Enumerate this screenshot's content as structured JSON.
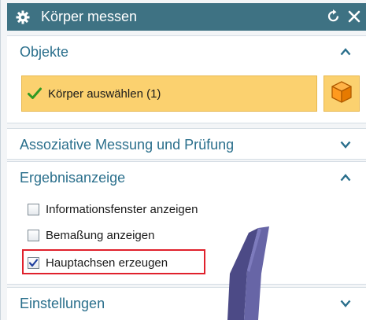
{
  "dialog": {
    "title": "Körper messen",
    "icons": {
      "settings": "gear-icon",
      "reset": "reset-icon",
      "close": "close-icon"
    }
  },
  "sections": {
    "objekte": {
      "label": "Objekte",
      "expanded": true,
      "select_label": "Körper auswählen (1)",
      "select_icon": "checkmark-icon",
      "body_icon": "cube-icon"
    },
    "assoziativ": {
      "label": "Assoziative Messung und Prüfung",
      "expanded": false
    },
    "ergebnis": {
      "label": "Ergebnisanzeige",
      "expanded": true,
      "options": [
        {
          "label": "Informationsfenster anzeigen",
          "checked": false
        },
        {
          "label": "Bemaßung anzeigen",
          "checked": false
        },
        {
          "label": "Hauptachsen erzeugen",
          "checked": true
        }
      ]
    },
    "einstellungen": {
      "label": "Einstellungen",
      "expanded": false
    }
  },
  "colors": {
    "titlebar": "#3e7283",
    "section_label": "#2a6f8c",
    "selection": "#fbd16f",
    "highlight": "#e0212c",
    "body_object": "#5a5a95"
  }
}
